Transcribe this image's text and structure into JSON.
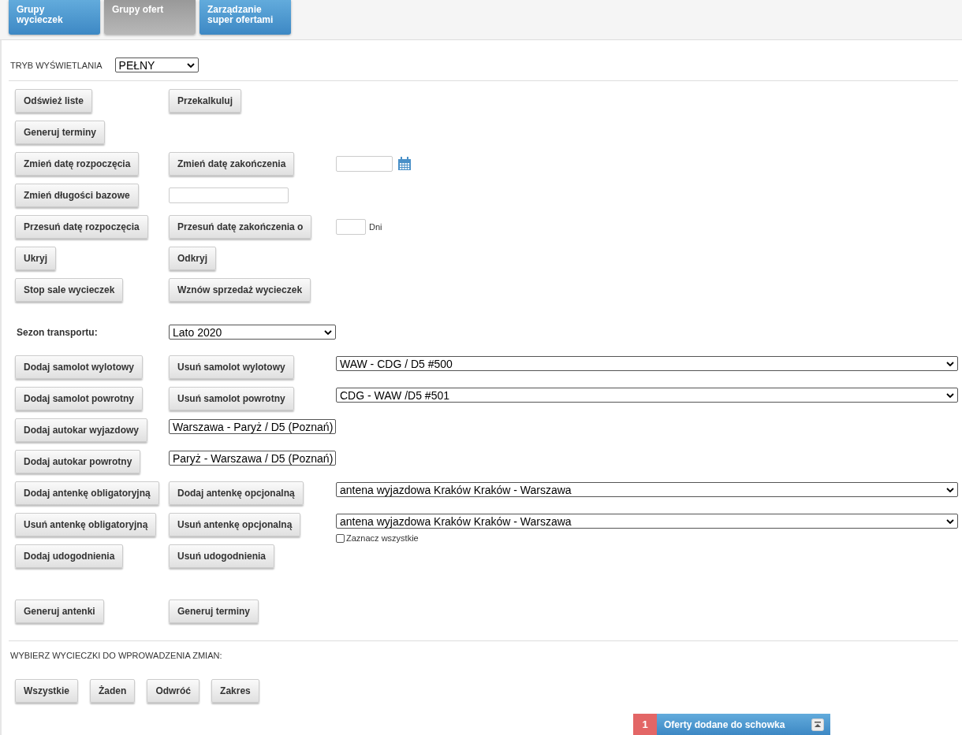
{
  "tabs": [
    {
      "label": "Grupy wycieczek",
      "selected": false
    },
    {
      "label": "Grupy ofert",
      "selected": true
    },
    {
      "label": "Zarządzanie super ofertami",
      "selected": false
    }
  ],
  "display_mode": {
    "label": "TRYB WYŚWIETLANIA",
    "value": "PEŁNY"
  },
  "sections": [
    {
      "rows": [
        {
          "items": [
            {
              "kind": "button",
              "label": "Odśwież liste"
            },
            {
              "kind": "button",
              "label": "Przekalkuluj"
            }
          ]
        },
        {
          "items": [
            {
              "kind": "button",
              "label": "Generuj terminy"
            }
          ]
        },
        {
          "items": [
            {
              "kind": "button",
              "label": "Zmień datę rozpoczęcia"
            },
            {
              "kind": "button",
              "label": "Zmień datę zakończenia"
            },
            {
              "kind": "date"
            }
          ]
        },
        {
          "items": [
            {
              "kind": "button",
              "label": "Zmień długości bazowe"
            },
            {
              "kind": "input"
            }
          ]
        },
        {
          "items": [
            {
              "kind": "button",
              "label": "Przesuń datę rozpoczęcia"
            },
            {
              "kind": "button",
              "label": "Przesuń datę zakończenia o"
            },
            {
              "kind": "days",
              "unit": "Dni"
            }
          ]
        },
        {
          "items": [
            {
              "kind": "button",
              "label": "Ukryj"
            },
            {
              "kind": "button",
              "label": "Odkryj"
            }
          ]
        },
        {
          "items": [
            {
              "kind": "button",
              "label": "Stop sale wycieczek"
            },
            {
              "kind": "button",
              "label": "Wznów sprzedaż wycieczek"
            }
          ]
        }
      ]
    },
    {
      "rows": [
        {
          "items": [
            {
              "kind": "label",
              "label": "Sezon transportu:"
            },
            {
              "kind": "select",
              "value": "Lato 2020"
            }
          ]
        },
        {
          "items": [
            {
              "kind": "button",
              "label": "Dodaj samolot wylotowy"
            },
            {
              "kind": "button",
              "label": "Usuń samolot wylotowy"
            },
            {
              "kind": "select",
              "value": "WAW - CDG / D5 #500"
            }
          ]
        },
        {
          "items": [
            {
              "kind": "button",
              "label": "Dodaj samolot powrotny"
            },
            {
              "kind": "button",
              "label": "Usuń samolot powrotny"
            },
            {
              "kind": "select",
              "value": "CDG - WAW /D5 #501"
            }
          ]
        },
        {
          "items": [
            {
              "kind": "button",
              "label": "Dodaj autokar wyjazdowy"
            },
            {
              "kind": "select",
              "value": "Warszawa - Paryż / D5 (Poznań)"
            }
          ]
        },
        {
          "items": [
            {
              "kind": "button",
              "label": "Dodaj autokar powrotny"
            },
            {
              "kind": "select",
              "value": "Paryż - Warszawa / D5 (Poznań)"
            }
          ]
        },
        {
          "items": [
            {
              "kind": "button",
              "label": "Dodaj antenkę obligatoryjną"
            },
            {
              "kind": "button",
              "label": "Dodaj antenkę opcjonalną"
            },
            {
              "kind": "select",
              "value": "antena wyjazdowa Kraków Kraków - Warszawa"
            }
          ]
        },
        {
          "items": [
            {
              "kind": "button",
              "label": "Usuń antenkę obligatoryjną"
            },
            {
              "kind": "button",
              "label": "Usuń antenkę opcjonalną"
            },
            {
              "kind": "select",
              "value": "antena wyjazdowa Kraków Kraków - Warszawa",
              "checkbox": {
                "label": "Zaznacz wszystkie",
                "checked": false
              }
            }
          ]
        },
        {
          "items": [
            {
              "kind": "button",
              "label": "Dodaj udogodnienia"
            },
            {
              "kind": "button",
              "label": "Usuń udogodnienia"
            }
          ]
        }
      ]
    },
    {
      "rows": [
        {
          "items": [
            {
              "kind": "button",
              "label": "Generuj antenki"
            },
            {
              "kind": "button",
              "label": "Generuj terminy"
            }
          ]
        }
      ]
    }
  ],
  "select_trips": {
    "label": "WYBIERZ WYCIECZKI DO WPROWADZENIA ZMIAN:",
    "buttons": [
      "Wszystkie",
      "Żaden",
      "Odwróć",
      "Zakres"
    ]
  },
  "clipboard": {
    "count": "1",
    "label": "Oferty dodane do schowka"
  }
}
